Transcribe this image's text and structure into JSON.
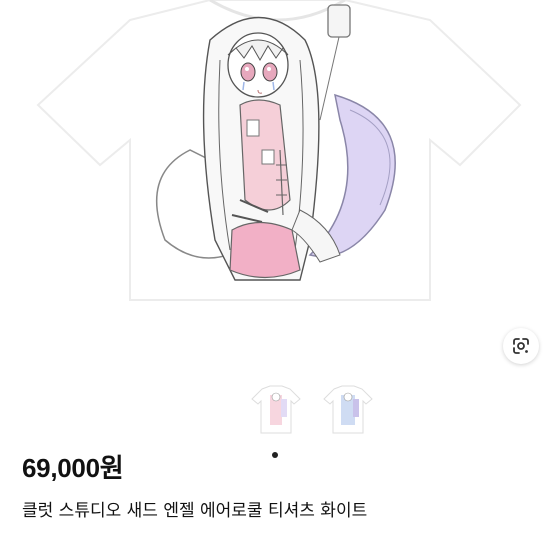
{
  "product": {
    "price": "69,000원",
    "title": "클럿 스튜디오 새드 엔젤 에어로쿨 티셔츠 화이트",
    "image_description_icon": "tshirt-with-anime-angel-illustration",
    "thumbnails": [
      {
        "name": "front-tshirt-thumbnail"
      },
      {
        "name": "blue-tshirt-thumbnail"
      }
    ],
    "gallery_page": 1
  },
  "controls": {
    "lens_icon": "google-lens-icon"
  },
  "colors": {
    "accent_dot": "#222222",
    "pink": "#f2b9c8",
    "lavender": "#cfc4ee"
  }
}
